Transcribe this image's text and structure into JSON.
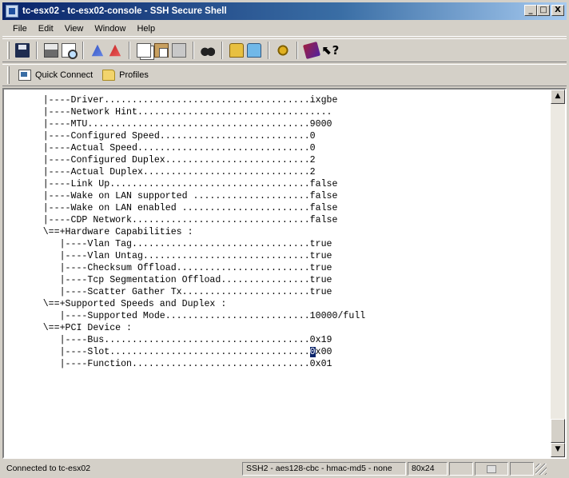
{
  "window": {
    "title": "tc-esx02 - tc-esx02-console - SSH Secure Shell",
    "controls": {
      "minimize": "_",
      "maximize": "□",
      "close": "X"
    }
  },
  "menu": [
    "File",
    "Edit",
    "View",
    "Window",
    "Help"
  ],
  "toolbar": {
    "icons": [
      "save-icon",
      "print-icon",
      "print-preview-icon",
      "keys-icon",
      "keys-alt-icon",
      "copy-icon",
      "paste-icon",
      "paste-alt-icon",
      "find-icon",
      "sftp-icon",
      "sftp-alt-icon",
      "settings-icon",
      "book-icon",
      "help-icon"
    ],
    "help_glyph": "⬉?"
  },
  "quickbar": {
    "quick_connect": "Quick Connect",
    "profiles": "Profiles"
  },
  "terminal": {
    "lines": [
      "       |----Driver.....................................ixgbe",
      "       |----Network Hint...................................",
      "       |----MTU........................................9000",
      "       |----Configured Speed...........................0",
      "       |----Actual Speed...............................0",
      "       |----Configured Duplex..........................2",
      "       |----Actual Duplex..............................2",
      "       |----Link Up....................................false",
      "       |----Wake on LAN supported .....................false",
      "       |----Wake on LAN enabled .......................false",
      "       |----CDP Network................................false",
      "       \\==+Hardware Capabilities :",
      "          |----Vlan Tag................................true",
      "          |----Vlan Untag..............................true",
      "          |----Checksum Offload........................true",
      "          |----Tcp Segmentation Offload................true",
      "          |----Scatter Gather Tx.......................true",
      "       \\==+Supported Speeds and Duplex :",
      "          |----Supported Mode..........................10000/full",
      "       \\==+PCI Device :",
      "          |----Bus.....................................0x19",
      "          |----Slot....................................",
      "          |----Function................................0x01"
    ],
    "cursor_line": 21,
    "cursor_char": "0",
    "cursor_rest": "x00"
  },
  "statusbar": {
    "connection": "Connected to tc-esx02",
    "encryption": "SSH2 - aes128-cbc - hmac-md5 - none",
    "size": "80x24"
  }
}
